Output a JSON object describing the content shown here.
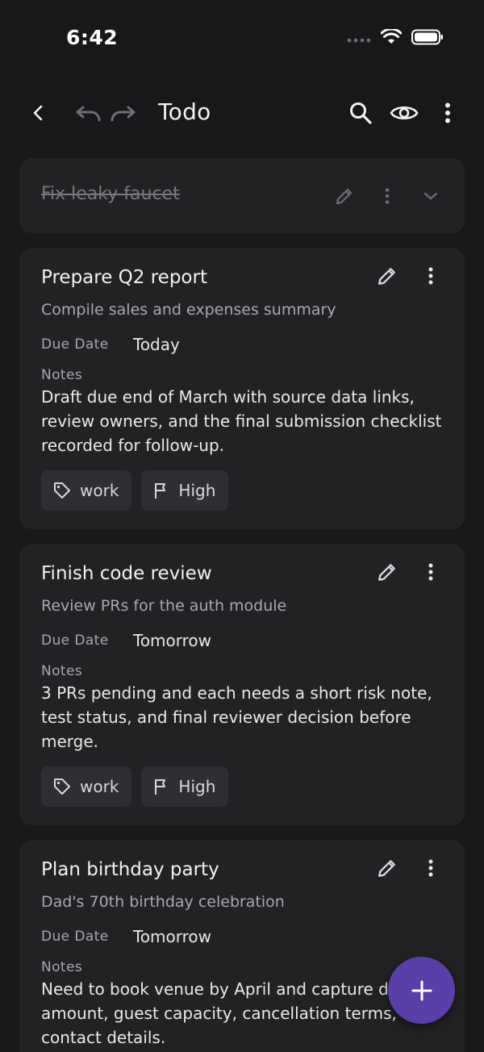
{
  "status_bar": {
    "time": "6:42"
  },
  "app_bar": {
    "title": "Todo"
  },
  "tasks": [
    {
      "title": "Fix leaky faucet",
      "completed": true
    },
    {
      "title": "Prepare Q2 report",
      "description": "Compile sales and expenses summary",
      "due_label": "Due Date",
      "due_value": "Today",
      "notes_label": "Notes",
      "notes": "Draft due end of March with source data links, review owners, and the final submission checklist recorded for follow-up.",
      "tag": "work",
      "priority": "High"
    },
    {
      "title": "Finish code review",
      "description": "Review PRs for the auth module",
      "due_label": "Due Date",
      "due_value": "Tomorrow",
      "notes_label": "Notes",
      "notes": "3 PRs pending and each needs a short risk note, test status, and final reviewer decision before merge.",
      "tag": "work",
      "priority": "High"
    },
    {
      "title": "Plan birthday party",
      "description": "Dad's 70th birthday celebration",
      "due_label": "Due Date",
      "due_value": "Tomorrow",
      "notes_label": "Notes",
      "notes": "Need to book venue by April and capture de... amount, guest capacity, cancellation terms, a... contact details."
    }
  ],
  "colors": {
    "background": "#18181a",
    "card": "#222225",
    "chip": "#2f2f33",
    "fab": "#5b3fa8"
  }
}
